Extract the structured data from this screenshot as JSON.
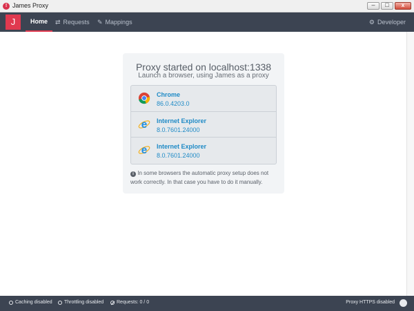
{
  "window": {
    "title": "James Proxy",
    "app_icon_glyph": "!"
  },
  "navbar": {
    "brand": "J",
    "items": [
      {
        "label": "Home",
        "icon": "home",
        "active": true
      },
      {
        "label": "Requests",
        "icon": "arrows-exchange-icon"
      },
      {
        "label": "Mappings",
        "icon": "plug-icon"
      }
    ],
    "developer": {
      "label": "Developer",
      "icon": "gear-icon"
    }
  },
  "main": {
    "headline": "Proxy started on localhost:1338",
    "subline": "Launch a browser, using James as a proxy",
    "browsers": [
      {
        "name": "Chrome",
        "version": "86.0.4203.0",
        "icon": "chrome-icon"
      },
      {
        "name": "Internet Explorer",
        "version": "8.0.7601.24000",
        "icon": "ie-icon"
      },
      {
        "name": "Internet Explorer",
        "version": "8.0.7601.24000",
        "icon": "ie-icon"
      }
    ],
    "note": "In some browsers the automatic proxy setup does not work correctly. In that case you have to do it manually."
  },
  "statusbar": {
    "caching": "Caching disabled",
    "throttling": "Throttling disabled",
    "requests": "Requests: 0 / 0",
    "https": "Proxy HTTPS disabled"
  },
  "colors": {
    "accent": "#e0394f",
    "nav_bg": "#3c4452",
    "link": "#1e8ac6"
  }
}
